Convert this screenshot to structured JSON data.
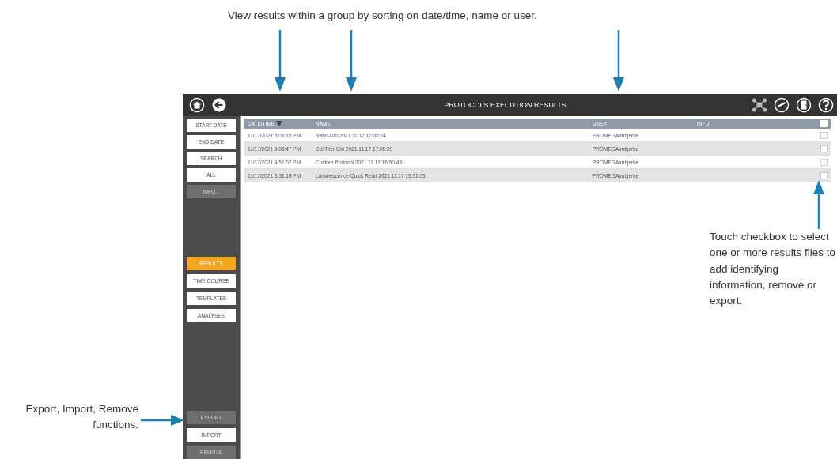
{
  "annotations": {
    "top": "View results within a group by sorting on date/time, name or user.",
    "right": "Touch checkbox to select one or more results files to add identifying information, remove or export.",
    "left": "Export, Import, Remove functions."
  },
  "window": {
    "title": "PROTOCOLS EXECUTION RESULTS"
  },
  "sidebar": {
    "filter_buttons": [
      {
        "label": "START DATE",
        "disabled": false
      },
      {
        "label": "END DATE",
        "disabled": false
      },
      {
        "label": "SEARCH",
        "disabled": false
      },
      {
        "label": "ALL",
        "disabled": false
      },
      {
        "label": "INFO...",
        "disabled": true
      }
    ],
    "view_buttons": [
      {
        "label": "RESULTS",
        "selected": true
      },
      {
        "label": "TIME COURSE",
        "selected": false
      },
      {
        "label": "TEMPLATES",
        "selected": false
      },
      {
        "label": "ANALYSES",
        "selected": false
      }
    ],
    "file_buttons": [
      {
        "label": "EXPORT",
        "disabled": true
      },
      {
        "label": "IMPORT",
        "disabled": false
      },
      {
        "label": "REMOVE",
        "disabled": true
      }
    ]
  },
  "table": {
    "columns": [
      {
        "label": "DATE/TIME",
        "sorted": true
      },
      {
        "label": "NAME",
        "sorted": false
      },
      {
        "label": "USER",
        "sorted": false
      },
      {
        "label": "INFO",
        "sorted": false
      }
    ],
    "select_all_checked": false,
    "rows": [
      {
        "date_time": "11/17/2021 5:06:15 PM",
        "name": "Nano-Glo 2021.11.17 17:06:04",
        "user": "PROMEGA\\mbjerke",
        "checked": false
      },
      {
        "date_time": "11/17/2021 5:05:47 PM",
        "name": "CellTiter-Glo 2021.11.17 17:05:29",
        "user": "PROMEGA\\mbjerke",
        "checked": false
      },
      {
        "date_time": "11/17/2021 4:51:07 PM",
        "name": "Custom Protocol 2021.11.17 16:50:49",
        "user": "PROMEGA\\mbjerke",
        "checked": false
      },
      {
        "date_time": "11/17/2021 3:31:18 PM",
        "name": "Luminescence Quick Read 2021.11.17 15:31:03",
        "user": "PROMEGA\\mbjerke",
        "checked": false
      }
    ]
  }
}
